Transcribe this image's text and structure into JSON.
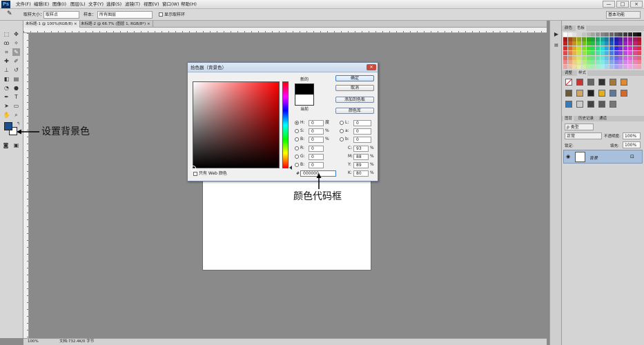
{
  "app": {
    "logo": "Ps"
  },
  "menu": [
    "文件(F)",
    "编辑(E)",
    "图像(I)",
    "图层(L)",
    "文字(Y)",
    "选择(S)",
    "滤镜(T)",
    "视图(V)",
    "窗口(W)",
    "帮助(H)"
  ],
  "window_buttons": [
    "—",
    "□",
    "×"
  ],
  "options_bar": {
    "sample_size_label": "取样大小：",
    "sample_size_value": "取样点",
    "sample_label": "样本：",
    "sample_value": "所有图层",
    "show_ring_label": "显示取样环",
    "workspace": "基本功能"
  },
  "tabs": [
    "未标题-1 @ 100%(RGB/8) ×",
    "未标题-2 @ 66.7% (图层 1, RGB/8*) ×"
  ],
  "status": {
    "zoom": "100%",
    "doc": "文档:732.4K/0 字节"
  },
  "right_panels": {
    "color_tabs": [
      "颜色",
      "色板"
    ],
    "adjust_tabs": [
      "调整",
      "样式"
    ],
    "layers_tabs": [
      "图层",
      "历史记录",
      "通道"
    ],
    "kind_label": "ρ 类型",
    "blend_mode": "正常",
    "opacity_label": "不透明度:",
    "opacity_value": "100%",
    "lock_label": "锁定:",
    "fill_label": "填充:",
    "fill_value": "100%",
    "layer_name": "背景"
  },
  "dialog": {
    "title": "拾色器（背景色）",
    "new_label": "新的",
    "current_label": "当前",
    "new_color": "#000000",
    "current_color": "#ffffff",
    "buttons": {
      "ok": "确定",
      "cancel": "取消",
      "add_swatch": "添加到色板",
      "libraries": "颜色库"
    },
    "web_only_label": "只有 Web 颜色",
    "fields": {
      "H": {
        "label": "H:",
        "value": "0",
        "unit": "度"
      },
      "S": {
        "label": "S:",
        "value": "0",
        "unit": "%"
      },
      "B": {
        "label": "B:",
        "value": "0",
        "unit": "%"
      },
      "R": {
        "label": "R:",
        "value": "0"
      },
      "G": {
        "label": "G:",
        "value": "0"
      },
      "Bl": {
        "label": "B:",
        "value": "0"
      },
      "L": {
        "label": "L:",
        "value": "0"
      },
      "a": {
        "label": "a:",
        "value": "0"
      },
      "b": {
        "label": "b:",
        "value": "0"
      },
      "C": {
        "label": "C:",
        "value": "93",
        "unit": "%"
      },
      "M": {
        "label": "M:",
        "value": "88",
        "unit": "%"
      },
      "Y": {
        "label": "Y:",
        "value": "89",
        "unit": "%"
      },
      "K": {
        "label": "K:",
        "value": "80",
        "unit": "%"
      }
    },
    "hex_label": "#",
    "hex_value": "000000"
  },
  "annotations": {
    "background": "设置背景色",
    "hex": "颜色代码框"
  },
  "colors": {
    "foreground": "#1a4f8f",
    "background": "#ffffff",
    "accent": "#3b80cc"
  }
}
